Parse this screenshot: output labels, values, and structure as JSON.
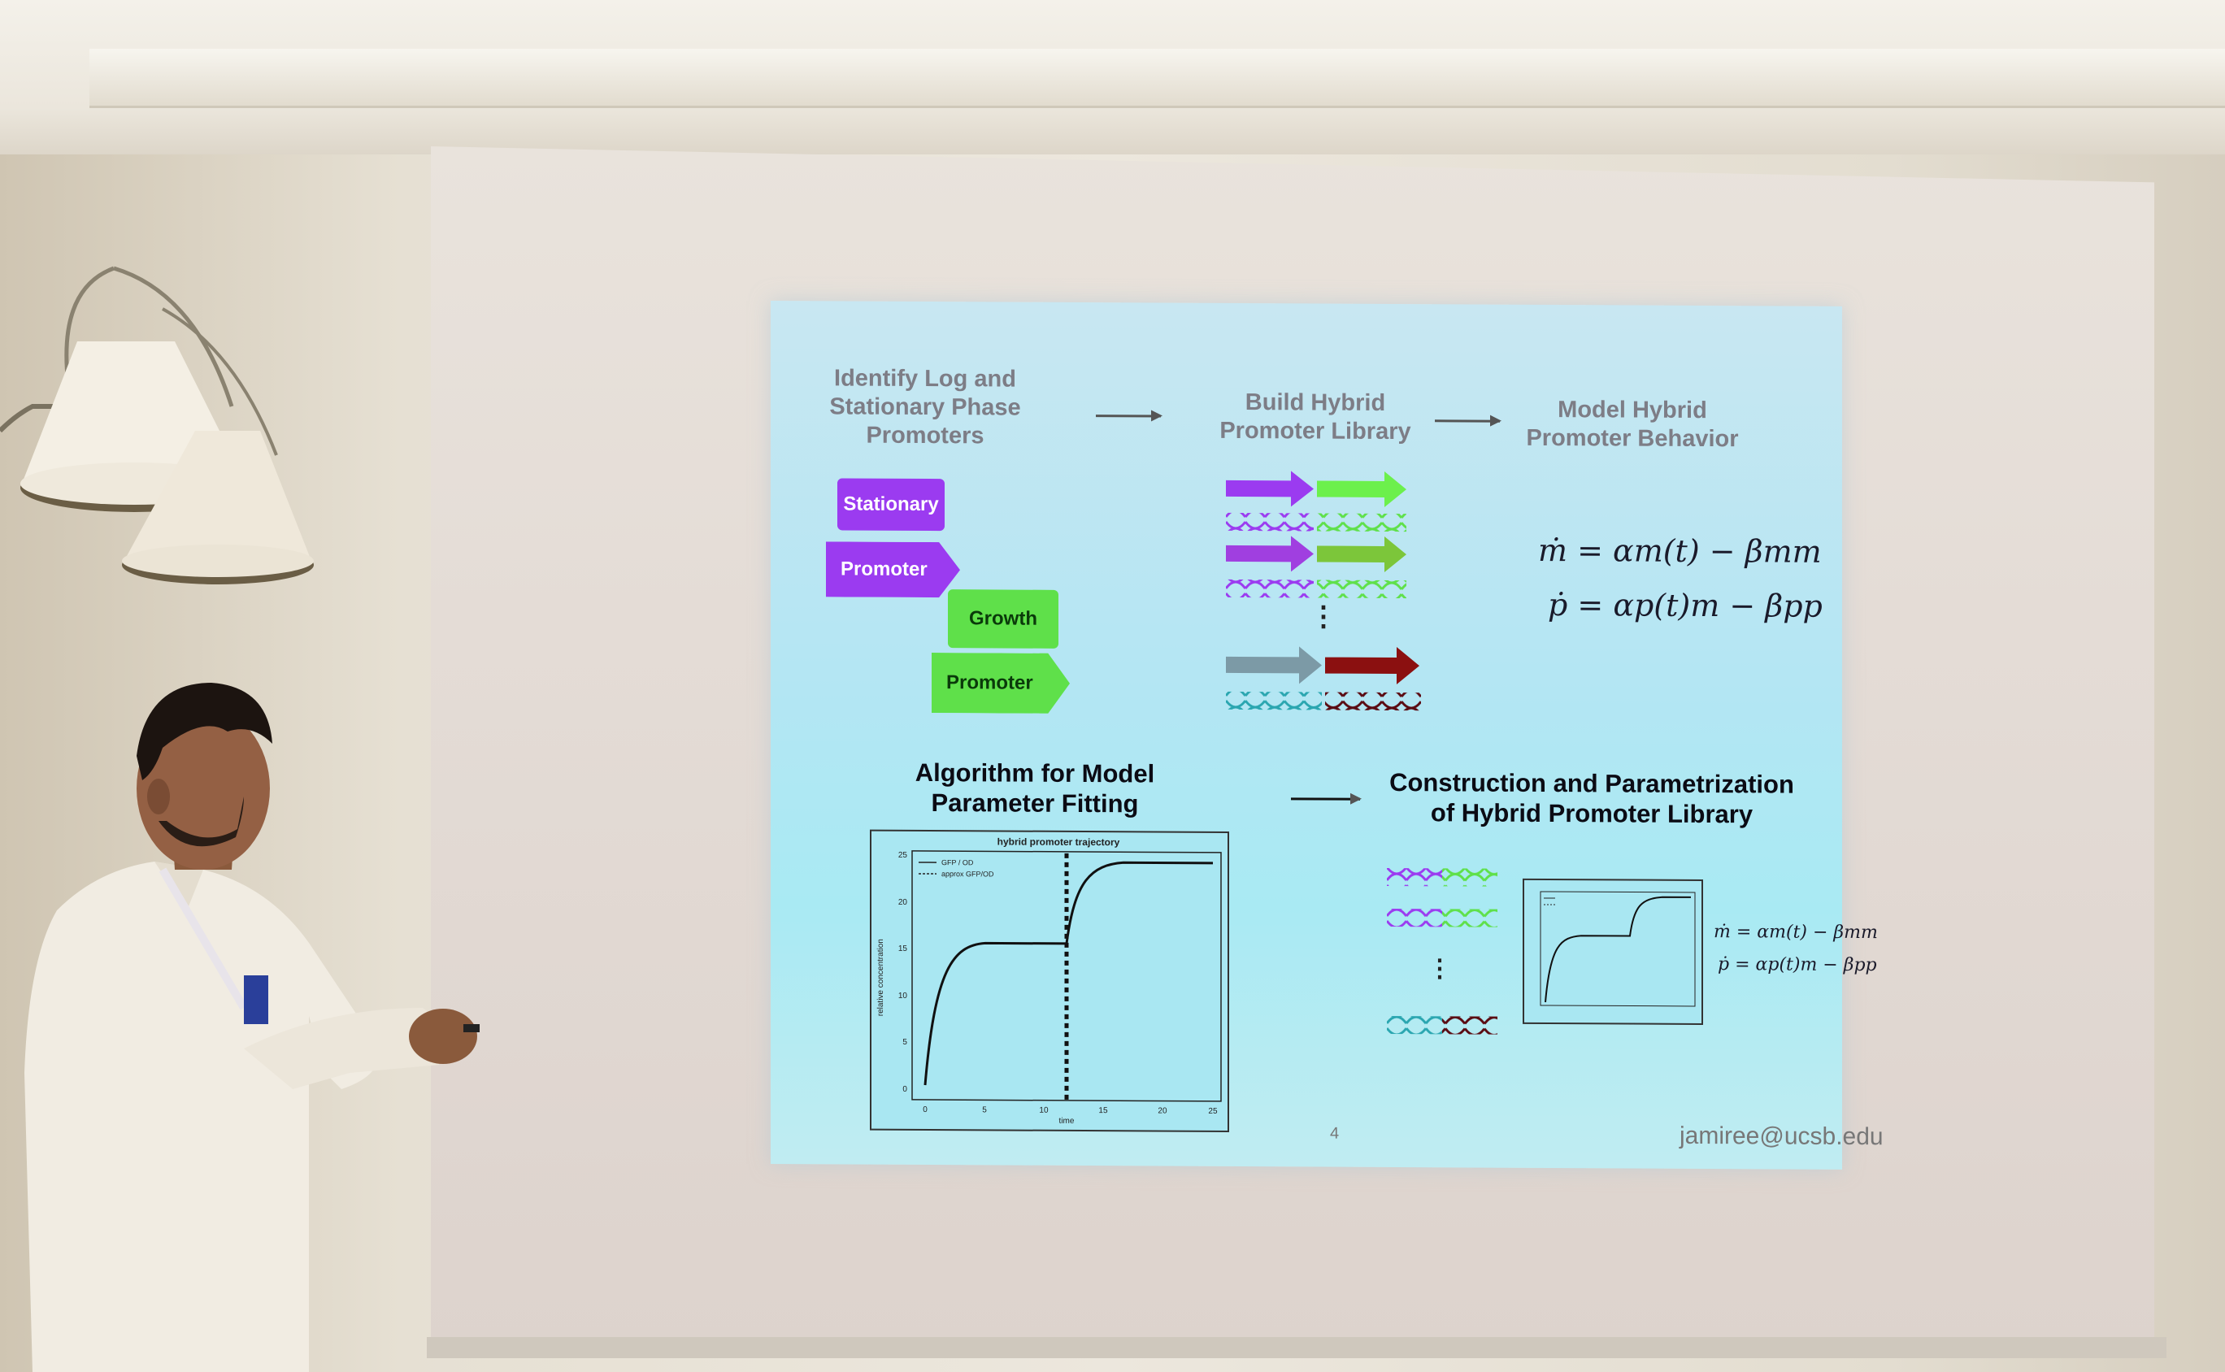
{
  "slide": {
    "step1_title": "Identify Log and\nStationary Phase\nPromoters",
    "step2_title": "Build Hybrid\nPromoter Library",
    "step3_title": "Model Hybrid\nPromoter Behavior",
    "step4_title": "Algorithm for Model\nParameter Fitting",
    "step5_title": "Construction and Parametrization\nof Hybrid Promoter Library",
    "block_stationary": "Stationary",
    "block_promoter_1": "Promoter",
    "block_growth": "Growth",
    "block_promoter_2": "Promoter",
    "eq_m": "ṁ = αm(t) − βmm",
    "eq_p": "ṗ = αp(t)m − βpp",
    "eq_m_small": "ṁ = αm(t) − βmm",
    "eq_p_small": "ṗ = αp(t)m − βpp",
    "vdots": "⋮",
    "page_number": "4",
    "email": "jamiree@ucsb.edu"
  },
  "plot": {
    "title": "hybrid promoter trajectory",
    "legend": [
      "GFP / OD",
      "approx GFP/OD"
    ],
    "ylabel": "relative concentration",
    "xlabel": "time",
    "yticks": [
      "0",
      "5",
      "10",
      "15",
      "20",
      "25"
    ],
    "xticks": [
      "0",
      "5",
      "10",
      "15",
      "20",
      "25"
    ]
  },
  "colors": {
    "stationary": "#9b3bf0",
    "growth": "#5fe04a",
    "gray_arrow": "#7c9aa6",
    "red_arrow": "#8b1010"
  }
}
